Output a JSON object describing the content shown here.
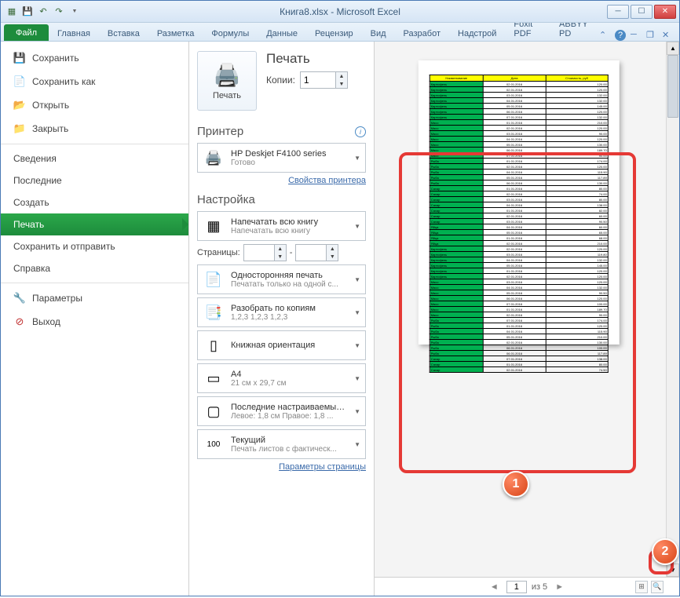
{
  "window": {
    "title": "Книга8.xlsx - Microsoft Excel"
  },
  "ribbon": {
    "file": "Файл",
    "tabs": [
      "Главная",
      "Вставка",
      "Разметка",
      "Формулы",
      "Данные",
      "Рецензир",
      "Вид",
      "Разработ",
      "Надстрой",
      "Foxit PDF",
      "ABBYY PD"
    ]
  },
  "menu": {
    "save": "Сохранить",
    "saveAs": "Сохранить как",
    "open": "Открыть",
    "close": "Закрыть",
    "info": "Сведения",
    "recent": "Последние",
    "new": "Создать",
    "print": "Печать",
    "sendSave": "Сохранить и отправить",
    "help": "Справка",
    "options": "Параметры",
    "exit": "Выход"
  },
  "print": {
    "header": "Печать",
    "button": "Печать",
    "copiesLabel": "Копии:",
    "copiesValue": "1",
    "printerHeader": "Принтер",
    "printerName": "HP Deskjet F4100 series",
    "printerStatus": "Готово",
    "printerProps": "Свойства принтера",
    "settingsHeader": "Настройка",
    "scope": {
      "title": "Напечатать всю книгу",
      "sub": "Напечатать всю книгу"
    },
    "pagesLabel": "Страницы:",
    "pagesTo": "-",
    "duplex": {
      "title": "Односторонняя печать",
      "sub": "Печатать только на одной с..."
    },
    "collate": {
      "title": "Разобрать по копиям",
      "sub": "1,2,3   1,2,3   1,2,3"
    },
    "orientation": {
      "title": "Книжная ориентация",
      "sub": ""
    },
    "paper": {
      "title": "A4",
      "sub": "21 см x 29,7 см"
    },
    "margins": {
      "title": "Последние настраиваемые ...",
      "sub": "Левое: 1,8 см   Правое: 1,8 ..."
    },
    "scaling": {
      "title": "Текущий",
      "sub": "Печать листов с фактическ..."
    },
    "pageSetup": "Параметры страницы"
  },
  "nav": {
    "page": "1",
    "of": "из 5"
  },
  "previewTable": {
    "headers": [
      "Наименование",
      "Дата",
      "Стоимость, руб"
    ],
    "rows": [
      [
        "Картофель",
        "02.01.2016",
        "120.00"
      ],
      [
        "Картофель",
        "02.01.2016",
        "120.00"
      ],
      [
        "Картофель",
        "03.01.2016",
        "132.00"
      ],
      [
        "Картофель",
        "04.01.2016",
        "132.00"
      ],
      [
        "Картофель",
        "05.01.2016",
        "145.00"
      ],
      [
        "Картофель",
        "06.01.2016",
        "120.00"
      ],
      [
        "Картофель",
        "07.01.2016",
        "132.00"
      ],
      [
        "Мясо",
        "01.01.2016",
        "210.00"
      ],
      [
        "Мясо",
        "02.01.2016",
        "120.00"
      ],
      [
        "Мясо",
        "03.01.2016",
        "90.00"
      ],
      [
        "Мясо",
        "04.01.2016",
        "120.00"
      ],
      [
        "Мясо",
        "05.01.2016",
        "130.00"
      ],
      [
        "Мясо",
        "06.01.2016",
        "189.70"
      ],
      [
        "Мясо",
        "07.01.2016",
        "90.00"
      ],
      [
        "Рыба",
        "01.01.2016",
        "174.00"
      ],
      [
        "Рыба",
        "02.01.2016",
        "120.00"
      ],
      [
        "Рыба",
        "04.01.2016",
        "115.90"
      ],
      [
        "Рыба",
        "05.01.2016",
        "117.89"
      ],
      [
        "Рыба",
        "06.01.2016",
        "130.00"
      ],
      [
        "Сахар",
        "01.01.2016",
        "80.00"
      ],
      [
        "Сахар",
        "02.01.2016",
        "74.00"
      ],
      [
        "Сахар",
        "03.01.2016",
        "80.00"
      ],
      [
        "Сахар",
        "04.01.2016",
        "138.00"
      ],
      [
        "Сахар",
        "01.01.2016",
        "82.00"
      ],
      [
        "Сахар",
        "02.01.2016",
        "60.00"
      ],
      [
        "Сахар",
        "03.01.2016",
        "90.50"
      ],
      [
        "Яйца",
        "04.01.2016",
        "60.00"
      ],
      [
        "Яйца",
        "05.01.2016",
        "65.00"
      ],
      [
        "Яйца",
        "01.01.2016",
        "68.00"
      ],
      [
        "Яйца",
        "02.01.2016",
        "210.00"
      ],
      [
        "Картофель",
        "02.01.2016",
        "120.00"
      ],
      [
        "Картофель",
        "03.01.2016",
        "119.80"
      ],
      [
        "Картофель",
        "04.01.2016",
        "132.00"
      ],
      [
        "Картофель",
        "05.01.2016",
        "145.00"
      ],
      [
        "Картофель",
        "01.01.2016",
        "120.00"
      ],
      [
        "Картофель",
        "02.01.2016",
        "120.00"
      ],
      [
        "Мясо",
        "03.01.2016",
        "120.00"
      ],
      [
        "Мясо",
        "04.01.2016",
        "132.00"
      ],
      [
        "Мясо",
        "05.01.2016",
        "90.50"
      ],
      [
        "Мясо",
        "06.01.2016",
        "120.00"
      ],
      [
        "Мясо",
        "07.01.2016",
        "100.00"
      ],
      [
        "Мясо",
        "01.01.2016",
        "189.70"
      ],
      [
        "Мясо",
        "02.01.2016",
        "90.00"
      ],
      [
        "Рыба",
        "07.01.2016",
        "174.00"
      ],
      [
        "Рыба",
        "01.01.2016",
        "120.00"
      ],
      [
        "Рыба",
        "04.01.2016",
        "115.90"
      ],
      [
        "Рыба",
        "05.01.2016",
        "210.00"
      ],
      [
        "Рыба",
        "02.01.2016",
        "130.00"
      ],
      [
        "Рыба",
        "06.01.2016",
        "100.00"
      ],
      [
        "Рыба",
        "06.01.2016",
        "117.89"
      ],
      [
        "Сахар",
        "07.01.2016",
        "138.00"
      ],
      [
        "Сахар",
        "01.01.2016",
        "80.00"
      ],
      [
        "Сахар",
        "02.01.2016",
        "74.50"
      ]
    ]
  },
  "annotations": {
    "1": "1",
    "2": "2"
  }
}
